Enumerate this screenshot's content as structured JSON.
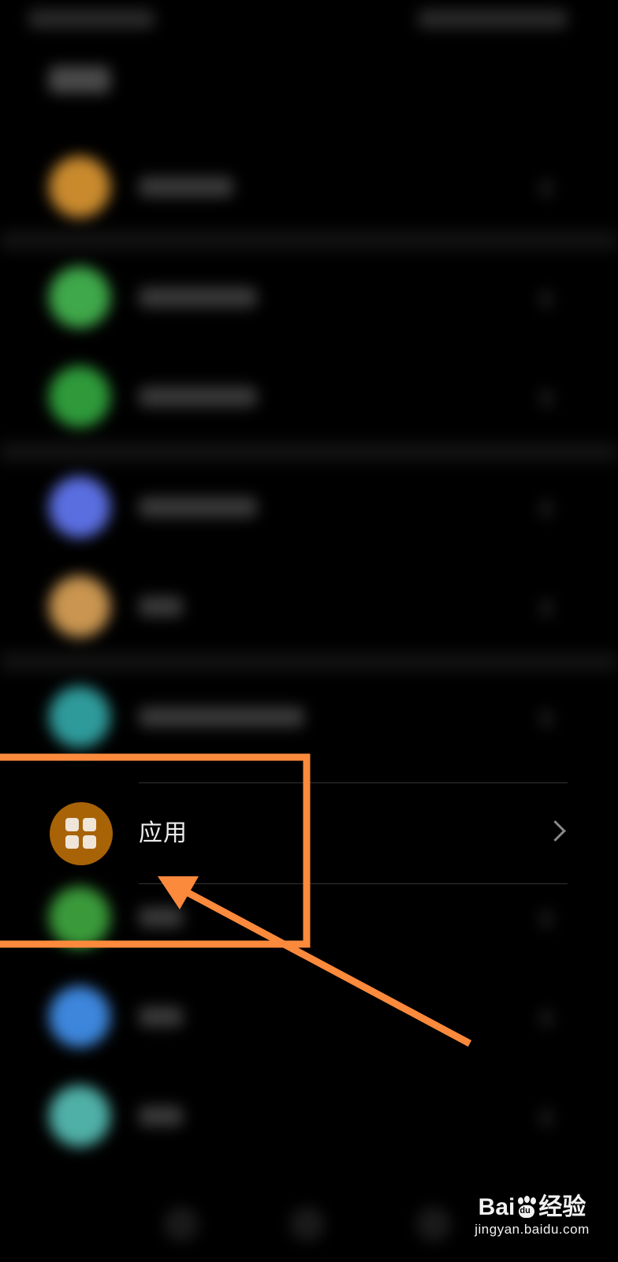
{
  "settings_list": {
    "focused_item": {
      "label": "应用",
      "icon": "apps-grid-icon",
      "icon_color": "#a86307",
      "chevron": "chevron-right-icon"
    },
    "blurred_icon_colors": [
      "#c98a2e",
      "#3fa84a",
      "#2e9a3a",
      "#5a6ee0",
      "#c99550",
      "#2f9a9a",
      "#3a9a3a",
      "#3d86dc",
      "#4fb0a8"
    ]
  },
  "annotation": {
    "highlight_color": "#fb8a3c"
  },
  "watermark": {
    "brand_left": "Bai",
    "brand_right": "经验",
    "paw_text": "du",
    "url": "jingyan.baidu.com"
  }
}
